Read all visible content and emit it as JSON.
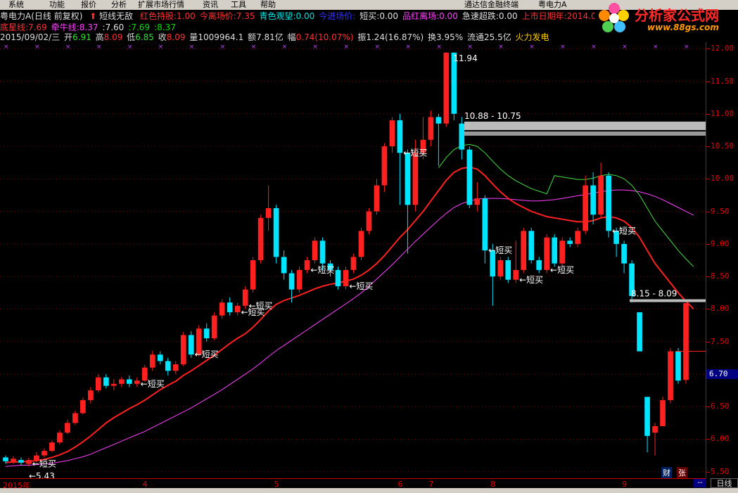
{
  "menu": {
    "items": [
      "系统",
      "功能",
      "报价",
      "分析",
      "扩展市场行情",
      "资讯",
      "工具",
      "帮助"
    ],
    "right_items": [
      "通达信金融终端",
      "粤电力A"
    ]
  },
  "header": {
    "stock_title": "粤电力A(日线 前复权)",
    "indicator_name": "短线无敌",
    "params": [
      {
        "label": "红色持股",
        "value": "1.00",
        "color": "#ff3030"
      },
      {
        "label": "今离场价",
        "value": "7.35",
        "color": "#ff3030"
      },
      {
        "label": "青色观望",
        "value": "0.00",
        "color": "#00e0e0"
      },
      {
        "label": "今进场价",
        "value": "",
        "color": "#3030ff"
      },
      {
        "label": "短买",
        "value": "0.00",
        "color": "#e0e0e0"
      },
      {
        "label": "品红离场",
        "value": "0.00",
        "color": "#ff40ff"
      },
      {
        "label": "急速超跌",
        "value": "0.00",
        "color": "#e0e0e0"
      },
      {
        "label": "上市日期年",
        "value": "2014.00",
        "color": "#ff3030"
      }
    ],
    "row2": [
      {
        "label": "底星线",
        "value": "7.69",
        "color": "#ff3030"
      },
      {
        "label": "牵牛线",
        "value": "8.37",
        "color": "#ff40ff"
      },
      {
        "label": "",
        "value": "7.60",
        "color": "#e0e0e0"
      },
      {
        "label": "",
        "value": "7.69",
        "color": "#00e000"
      },
      {
        "label": "",
        "value": "8.37",
        "color": "#00e000"
      }
    ],
    "quote": {
      "date": "2015/09/02/三",
      "open_label": "开",
      "open": "6.91",
      "high_label": "高",
      "high": "8.09",
      "low_label": "低",
      "low": "6.85",
      "close_label": "收",
      "close": "8.09",
      "vol_label": "量",
      "vol": "1009964.1",
      "amt_label": "额",
      "amt": "7.81亿",
      "chg_label": "幅",
      "chg": "0.74(10.07%)",
      "amp_label": "振",
      "amp": "1.24(16.87%)",
      "turn_label": "换",
      "turn": "3.95%",
      "float_label": "流通",
      "float": "25.5亿",
      "concept": "火力发电"
    }
  },
  "logo": {
    "text": "分析家公式网",
    "url": "www.88gs.com"
  },
  "colors": {
    "up": "#ff2020",
    "down": "#00e5ff",
    "ma_red": "#ff2020",
    "ma_magenta": "#ff40ff",
    "ma_green": "#40e040",
    "yellow": "#ffd000"
  },
  "chart_data": {
    "type": "candlestick",
    "ylim": [
      5.4,
      12.1
    ],
    "yticks": [
      "12.00",
      "11.50",
      "11.00",
      "10.50",
      "10.00",
      "9.50",
      "9.00",
      "8.50",
      "8.00",
      "7.50",
      "7.00",
      "6.50",
      "6.00",
      "5.50"
    ],
    "x_labels": [
      {
        "label": "2015年",
        "idx": 0
      },
      {
        "label": "4",
        "idx": 18
      },
      {
        "label": "5",
        "idx": 35
      },
      {
        "label": "6",
        "idx": 51
      },
      {
        "label": "7",
        "idx": 55
      },
      {
        "label": "8",
        "idx": 63
      },
      {
        "label": "9",
        "idx": 80
      }
    ],
    "current_price": "6.70",
    "annotations": [
      {
        "text": "11.94",
        "kind": "high"
      },
      {
        "text": "10.88 - 10.75",
        "kind": "band"
      },
      {
        "text": "8.15 - 8.09",
        "kind": "band"
      },
      {
        "text": "←5.43",
        "kind": "low"
      }
    ],
    "buy_label": "←短买",
    "buy_signals": [
      3,
      17,
      24,
      30,
      31,
      39,
      44,
      51,
      62,
      66,
      70,
      78
    ],
    "bars": [
      [
        5.72,
        5.66,
        5.75,
        5.62
      ],
      [
        5.66,
        5.7,
        5.74,
        5.62
      ],
      [
        5.68,
        5.64,
        5.72,
        5.6
      ],
      [
        5.62,
        5.68,
        5.72,
        5.58
      ],
      [
        5.68,
        5.75,
        5.8,
        5.64
      ],
      [
        5.75,
        5.82,
        5.86,
        5.72
      ],
      [
        5.82,
        5.95,
        5.98,
        5.8
      ],
      [
        5.95,
        6.1,
        6.14,
        5.92
      ],
      [
        6.1,
        6.25,
        6.3,
        6.08
      ],
      [
        6.25,
        6.4,
        6.44,
        6.22
      ],
      [
        6.4,
        6.6,
        6.64,
        6.38
      ],
      [
        6.6,
        6.75,
        6.8,
        6.55
      ],
      [
        6.75,
        6.95,
        7.0,
        6.72
      ],
      [
        6.95,
        6.82,
        7.0,
        6.78
      ],
      [
        6.82,
        6.85,
        6.92,
        6.75
      ],
      [
        6.85,
        6.92,
        6.96,
        6.8
      ],
      [
        6.92,
        6.85,
        6.98,
        6.8
      ],
      [
        6.85,
        6.9,
        6.95,
        6.8
      ],
      [
        6.9,
        7.1,
        7.14,
        6.88
      ],
      [
        7.1,
        7.3,
        7.36,
        7.05
      ],
      [
        7.3,
        7.2,
        7.35,
        7.15
      ],
      [
        7.2,
        7.05,
        7.25,
        6.98
      ],
      [
        7.05,
        7.15,
        7.2,
        7.0
      ],
      [
        7.15,
        7.6,
        7.65,
        7.12
      ],
      [
        7.6,
        7.3,
        7.66,
        7.25
      ],
      [
        7.3,
        7.7,
        7.75,
        7.28
      ],
      [
        7.7,
        7.55,
        7.78,
        7.5
      ],
      [
        7.55,
        7.9,
        7.95,
        7.52
      ],
      [
        7.9,
        8.1,
        8.15,
        7.85
      ],
      [
        8.1,
        7.95,
        8.18,
        7.9
      ],
      [
        7.95,
        8.05,
        8.1,
        7.9
      ],
      [
        8.05,
        8.3,
        8.35,
        8.0
      ],
      [
        8.3,
        8.75,
        8.8,
        8.25
      ],
      [
        8.75,
        9.4,
        9.45,
        8.7
      ],
      [
        9.4,
        9.55,
        9.9,
        9.2
      ],
      [
        9.55,
        8.8,
        9.6,
        8.7
      ],
      [
        8.8,
        8.55,
        8.9,
        8.45
      ],
      [
        8.55,
        8.3,
        8.6,
        8.1
      ],
      [
        8.3,
        8.6,
        8.65,
        8.25
      ],
      [
        8.6,
        8.75,
        8.8,
        8.55
      ],
      [
        8.75,
        9.05,
        9.1,
        8.7
      ],
      [
        9.05,
        8.7,
        9.1,
        8.6
      ],
      [
        8.7,
        8.6,
        8.75,
        8.5
      ],
      [
        8.6,
        8.35,
        8.65,
        8.3
      ],
      [
        8.35,
        8.6,
        8.65,
        8.3
      ],
      [
        8.6,
        8.8,
        8.85,
        8.55
      ],
      [
        8.8,
        9.2,
        9.25,
        8.75
      ],
      [
        9.2,
        9.5,
        9.55,
        9.15
      ],
      [
        9.5,
        9.9,
        10.0,
        9.45
      ],
      [
        9.9,
        10.5,
        10.55,
        9.8
      ],
      [
        10.5,
        10.9,
        10.95,
        10.4
      ],
      [
        10.9,
        10.4,
        11.0,
        9.6
      ],
      [
        10.4,
        9.6,
        10.45,
        8.85
      ],
      [
        9.6,
        10.4,
        10.6,
        9.5
      ],
      [
        10.4,
        10.6,
        10.95,
        10.3
      ],
      [
        10.6,
        10.95,
        11.05,
        10.5
      ],
      [
        10.95,
        10.85,
        11.0,
        10.2
      ],
      [
        10.85,
        11.94,
        11.94,
        10.8
      ],
      [
        11.94,
        11.0,
        11.94,
        10.9
      ],
      [
        10.85,
        10.45,
        10.95,
        10.3
      ],
      [
        10.45,
        9.6,
        10.5,
        9.55
      ],
      [
        9.6,
        9.7,
        9.95,
        9.5
      ],
      [
        9.7,
        8.9,
        9.75,
        8.7
      ],
      [
        8.9,
        8.5,
        9.0,
        8.05
      ],
      [
        8.5,
        8.75,
        8.8,
        8.45
      ],
      [
        8.75,
        8.45,
        8.8,
        8.4
      ],
      [
        8.45,
        8.6,
        9.05,
        8.4
      ],
      [
        8.6,
        9.2,
        9.25,
        8.55
      ],
      [
        9.2,
        8.75,
        9.25,
        8.7
      ],
      [
        8.75,
        8.6,
        8.8,
        8.55
      ],
      [
        8.6,
        9.1,
        9.15,
        8.55
      ],
      [
        9.1,
        8.7,
        9.15,
        8.65
      ],
      [
        8.7,
        9.05,
        9.1,
        8.65
      ],
      [
        9.05,
        9.0,
        9.1,
        8.95
      ],
      [
        9.0,
        9.2,
        9.25,
        8.95
      ],
      [
        9.2,
        9.9,
        10.05,
        9.15
      ],
      [
        9.9,
        9.45,
        10.1,
        9.3
      ],
      [
        9.45,
        10.05,
        10.25,
        9.4
      ],
      [
        10.05,
        9.2,
        10.1,
        9.1
      ],
      [
        9.2,
        9.0,
        9.25,
        8.8
      ],
      [
        9.0,
        8.7,
        9.05,
        8.55
      ],
      [
        8.7,
        8.2,
        8.75,
        8.1
      ],
      [
        7.95,
        7.35,
        7.95,
        7.35
      ],
      [
        6.65,
        6.05,
        6.65,
        5.8
      ],
      [
        6.1,
        6.2,
        6.25,
        5.75
      ],
      [
        6.2,
        6.6,
        6.65,
        6.2
      ],
      [
        6.6,
        7.35,
        7.4,
        6.55
      ],
      [
        7.35,
        6.9,
        7.4,
        6.85
      ],
      [
        6.91,
        8.09,
        8.09,
        6.85
      ]
    ],
    "ma_red": [
      5.64,
      5.65,
      5.65,
      5.66,
      5.67,
      5.69,
      5.72,
      5.76,
      5.81,
      5.88,
      5.96,
      6.05,
      6.15,
      6.25,
      6.33,
      6.4,
      6.47,
      6.53,
      6.6,
      6.68,
      6.76,
      6.83,
      6.89,
      6.98,
      7.05,
      7.13,
      7.21,
      7.29,
      7.38,
      7.47,
      7.55,
      7.62,
      7.72,
      7.84,
      7.97,
      8.07,
      8.13,
      8.17,
      8.21,
      8.26,
      8.31,
      8.35,
      8.38,
      8.4,
      8.43,
      8.46,
      8.52,
      8.6,
      8.7,
      8.82,
      8.96,
      9.1,
      9.22,
      9.36,
      9.5,
      9.66,
      9.82,
      9.98,
      10.1,
      10.16,
      10.18,
      10.15,
      10.05,
      9.92,
      9.8,
      9.7,
      9.62,
      9.56,
      9.5,
      9.46,
      9.42,
      9.4,
      9.38,
      9.36,
      9.34,
      9.34,
      9.36,
      9.4,
      9.42,
      9.4,
      9.35,
      9.25,
      9.1,
      8.9,
      8.7,
      8.55,
      8.4,
      8.25,
      8.12,
      8.0
    ],
    "ma_magenta": [
      5.58,
      5.59,
      5.6,
      5.6,
      5.61,
      5.62,
      5.63,
      5.65,
      5.67,
      5.7,
      5.73,
      5.77,
      5.82,
      5.87,
      5.92,
      5.97,
      6.02,
      6.07,
      6.12,
      6.18,
      6.24,
      6.3,
      6.36,
      6.42,
      6.48,
      6.55,
      6.62,
      6.69,
      6.76,
      6.84,
      6.92,
      7.0,
      7.08,
      7.17,
      7.27,
      7.36,
      7.44,
      7.52,
      7.6,
      7.68,
      7.76,
      7.84,
      7.92,
      8.0,
      8.08,
      8.16,
      8.25,
      8.35,
      8.46,
      8.57,
      8.68,
      8.8,
      8.92,
      9.04,
      9.15,
      9.26,
      9.37,
      9.47,
      9.56,
      9.62,
      9.66,
      9.69,
      9.7,
      9.7,
      9.7,
      9.69,
      9.68,
      9.67,
      9.66,
      9.66,
      9.67,
      9.68,
      9.7,
      9.72,
      9.74,
      9.76,
      9.78,
      9.8,
      9.82,
      9.83,
      9.83,
      9.82,
      9.8,
      9.77,
      9.73,
      9.68,
      9.62,
      9.56,
      9.5,
      9.44
    ]
  }
}
